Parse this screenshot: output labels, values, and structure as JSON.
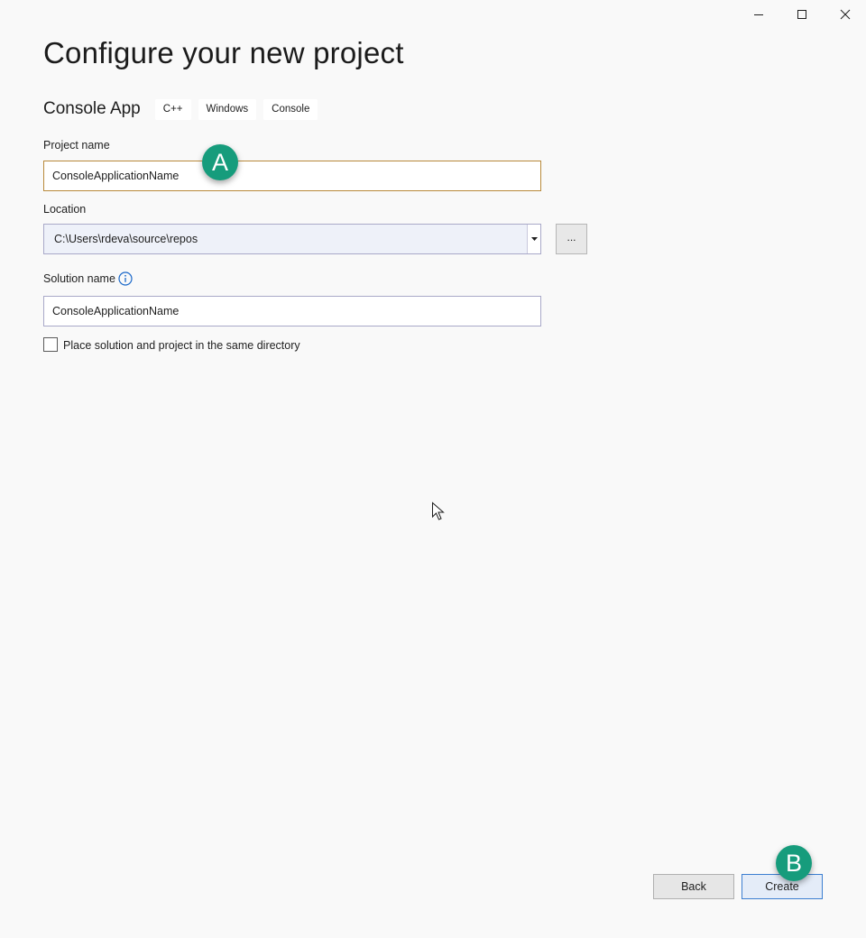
{
  "window": {
    "controls": [
      "minimize-icon",
      "maximize-icon",
      "close-icon"
    ]
  },
  "page": {
    "title": "Configure your new project"
  },
  "template": {
    "name": "Console App",
    "tags": [
      "C++",
      "Windows",
      "Console"
    ]
  },
  "form": {
    "project_name_label": "Project name",
    "project_name_value": "ConsoleApplicationName",
    "location_label": "Location",
    "location_value": "C:\\Users\\rdeva\\source\\repos",
    "browse_label": "...",
    "solution_name_label": "Solution name",
    "solution_name_value": "ConsoleApplicationName",
    "same_directory_label": "Place solution and project in the same directory",
    "same_directory_checked": false
  },
  "footer": {
    "back_label": "Back",
    "create_label": "Create"
  },
  "callouts": {
    "a": "A",
    "b": "B"
  },
  "colors": {
    "background": "#f9f9f9",
    "callout": "#169c7c",
    "focus_border": "#b8893a",
    "primary_border": "#3c7fd1"
  }
}
